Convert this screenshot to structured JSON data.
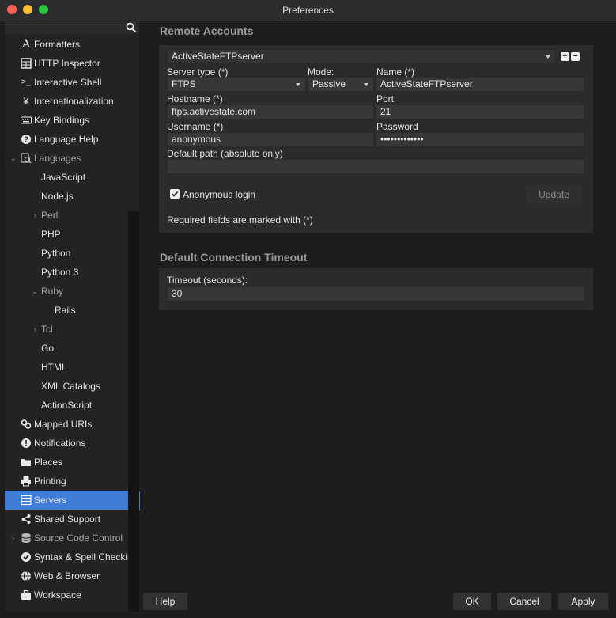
{
  "window": {
    "title": "Preferences"
  },
  "sidebar": {
    "items": [
      {
        "label": "Formatters",
        "icon": "formatter-icon"
      },
      {
        "label": "HTTP Inspector",
        "icon": "http-inspector-icon"
      },
      {
        "label": "Interactive Shell",
        "icon": "shell-prompt-icon"
      },
      {
        "label": "Internationalization",
        "icon": "yen-icon"
      },
      {
        "label": "Key Bindings",
        "icon": "keyboard-icon"
      },
      {
        "label": "Language Help",
        "icon": "help-icon"
      },
      {
        "label": "Languages",
        "icon": "languages-icon"
      },
      {
        "label": "JavaScript"
      },
      {
        "label": "Node.js"
      },
      {
        "label": "Perl"
      },
      {
        "label": "PHP"
      },
      {
        "label": "Python"
      },
      {
        "label": "Python 3"
      },
      {
        "label": "Ruby"
      },
      {
        "label": "Rails"
      },
      {
        "label": "Tcl"
      },
      {
        "label": "Go"
      },
      {
        "label": "HTML"
      },
      {
        "label": "XML Catalogs"
      },
      {
        "label": "ActionScript"
      },
      {
        "label": "Mapped URIs",
        "icon": "link-icon"
      },
      {
        "label": "Notifications",
        "icon": "notification-icon"
      },
      {
        "label": "Places",
        "icon": "folder-icon"
      },
      {
        "label": "Printing",
        "icon": "printer-icon"
      },
      {
        "label": "Servers",
        "icon": "servers-icon"
      },
      {
        "label": "Shared Support",
        "icon": "share-icon"
      },
      {
        "label": "Source Code Control",
        "icon": "database-icon"
      },
      {
        "label": "Syntax & Spell Checking",
        "icon": "check-circle-icon"
      },
      {
        "label": "Web & Browser",
        "icon": "globe-icon"
      },
      {
        "label": "Workspace",
        "icon": "briefcase-icon"
      }
    ]
  },
  "remote": {
    "title": "Remote Accounts",
    "account": "ActiveStateFTPserver",
    "server_type_label": "Server type (*)",
    "server_type": "FTPS",
    "mode_label": "Mode:",
    "mode": "Passive",
    "name_label": "Name (*)",
    "name": "ActiveStateFTPserver",
    "hostname_label": "Hostname (*)",
    "hostname": "ftps.activestate.com",
    "port_label": "Port",
    "port": "21",
    "username_label": "Username (*)",
    "username": "anonymous",
    "password_label": "Password",
    "password": "•••••••••••••",
    "default_path_label": "Default path (absolute only)",
    "default_path": "",
    "anonymous_label": "Anonymous login",
    "anonymous_checked": true,
    "update_label": "Update",
    "required_note": "Required fields are marked with (*)"
  },
  "timeout": {
    "title": "Default Connection Timeout",
    "label": "Timeout (seconds):",
    "value": "30"
  },
  "buttons": {
    "help": "Help",
    "ok": "OK",
    "cancel": "Cancel",
    "apply": "Apply"
  },
  "colors": {
    "selection": "#3f7dd9",
    "background": "#1d1d1f",
    "panel": "#2b2b2d"
  }
}
